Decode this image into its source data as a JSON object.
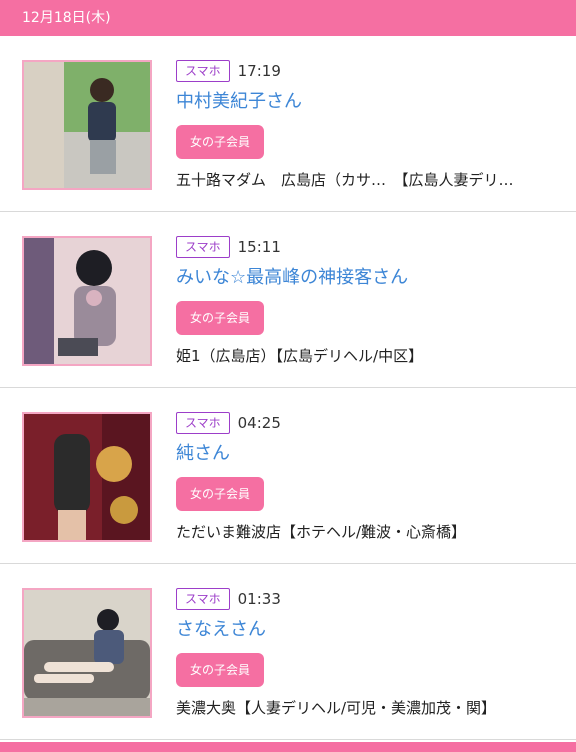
{
  "header": {
    "date": "12月18日(木)"
  },
  "items": [
    {
      "device": "スマホ",
      "time": "17:19",
      "name": "中村美紀子さん",
      "member": "女の子会員",
      "shop": "五十路マダム　広島店（カサ…　【広島人妻デリ…",
      "thumb_colors": [
        "#7fb06a",
        "#c9c7c1",
        "#3b3b45"
      ]
    },
    {
      "device": "スマホ",
      "time": "15:11",
      "name": "みいな☆最高峰の神接客さん",
      "member": "女の子会員",
      "shop": "姫1（広島店）【広島デリヘル/中区】",
      "thumb_colors": [
        "#e7d3d6",
        "#9a8b9a",
        "#4b4b55"
      ]
    },
    {
      "device": "スマホ",
      "time": "04:25",
      "name": "純さん",
      "member": "女の子会員",
      "shop": "ただいま難波店【ホテヘル/難波・心斎橋】",
      "thumb_colors": [
        "#7a1f2a",
        "#d8a44a",
        "#2b2b2b"
      ]
    },
    {
      "device": "スマホ",
      "time": "01:33",
      "name": "さなえさん",
      "member": "女の子会員",
      "shop": "美濃大奥【人妻デリヘル/可児・美濃加茂・関】",
      "thumb_colors": [
        "#a9a49c",
        "#6e6a66",
        "#4c5a7a"
      ]
    }
  ]
}
